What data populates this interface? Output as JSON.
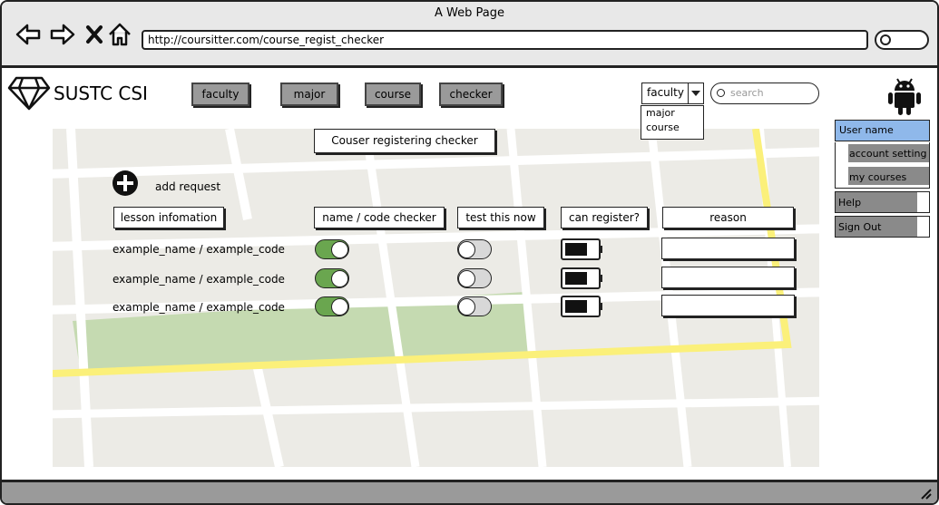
{
  "window": {
    "title": "A Web Page",
    "url": "http://coursitter.com/course_regist_checker"
  },
  "brand": {
    "name": "SUSTC CSI"
  },
  "nav": {
    "tabs": [
      {
        "label": "faculty"
      },
      {
        "label": "major"
      },
      {
        "label": "course"
      },
      {
        "label": "checker"
      }
    ]
  },
  "dropdown": {
    "selected": "faculty",
    "options": [
      "major",
      "course"
    ]
  },
  "search": {
    "placeholder": "search"
  },
  "user_menu": {
    "user_name": "User name",
    "account_setting": "account setting",
    "my_courses": "my courses",
    "help": "Help",
    "sign_out": "Sign Out"
  },
  "main": {
    "title": "Couser registering checker",
    "add_request": "add request",
    "headers": {
      "lesson": "lesson infomation",
      "name_code": "name / code checker",
      "test_now": "test this now",
      "can_register": "can register?",
      "reason": "reason"
    },
    "rows": [
      {
        "label": "example_name / example_code",
        "name_code_on": true,
        "test_on": false
      },
      {
        "label": "example_name / example_code",
        "name_code_on": true,
        "test_on": false
      },
      {
        "label": "example_name / example_code",
        "name_code_on": true,
        "test_on": false
      }
    ]
  },
  "colors": {
    "toggle_on": "#6aa64f",
    "toggle_off": "#d8d8d8",
    "active_item": "#8fb8ea",
    "map_green": "#c5dab1",
    "map_road_yellow": "#fbf07a"
  }
}
